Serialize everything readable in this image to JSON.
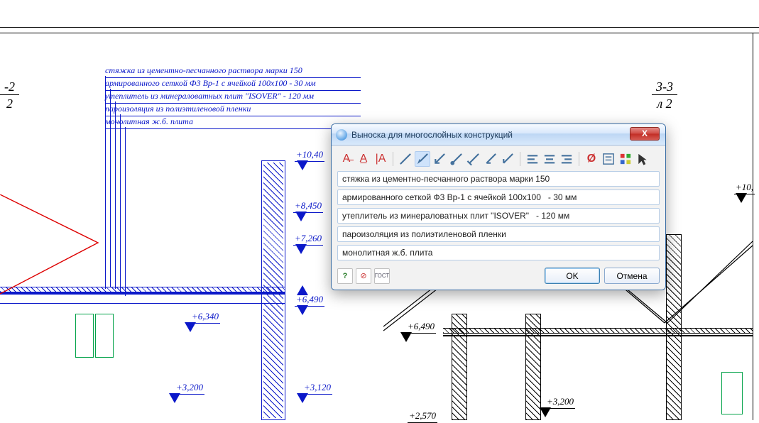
{
  "section_left": {
    "top": "-2",
    "bottom": "2"
  },
  "section_right": {
    "top": "3-3",
    "bottom": "л 2"
  },
  "notes": {
    "line1": "стяжка из цементно-песчанного раствора марки 150",
    "line2": "армированного сеткой Ф3 Вр-1 с ячейкой 100x100   - 30 мм",
    "line3": "утеплитель из минераловатных плит \"ISOVER\"   - 120 мм",
    "line4": "пароизоляция из полиэтиленовой пленки",
    "line5": "монолитная ж.б. плита"
  },
  "elev": {
    "e1": "+10,40",
    "e2": "+8,450",
    "e3": "+7,260",
    "e4": "+6,490",
    "e5": "+6,340",
    "e6": "+3,200",
    "e7": "+3,120",
    "e8": "+2,570",
    "e9_right": "+10,",
    "e10_right": "+6,490",
    "e11_right": "+3,200"
  },
  "dialog": {
    "title": "Выноска для многослойных конструкций",
    "row1": "стяжка из цементно-песчанного раствора марки 150",
    "row2": "армированного сеткой Ф3 Вр-1 с ячейкой 100x100   - 30 мм",
    "row3": "утеплитель из минераловатных плит \"ISOVER\"   - 120 мм",
    "row4": "пароизоляция из полиэтиленовой пленки",
    "row5": "монолитная ж.б. плита",
    "ok": "OK",
    "cancel": "Отмена",
    "close": "X"
  }
}
